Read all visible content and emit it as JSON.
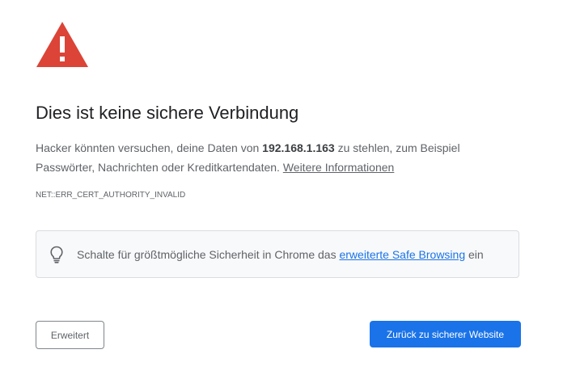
{
  "icons": {
    "warning": "warning-triangle-icon",
    "bulb": "lightbulb-icon"
  },
  "colors": {
    "warning_red": "#db4437",
    "primary_blue": "#1a73e8",
    "text_secondary": "#5f6368"
  },
  "heading": "Dies ist keine sichere Verbindung",
  "explanation": {
    "before_host": "Hacker könnten versuchen, deine Daten von ",
    "host": "192.168.1.163",
    "after_host": " zu stehlen, zum Beispiel Passwörter, Nachrichten oder Kreditkartendaten. ",
    "learn_more": "Weitere Informationen"
  },
  "error_code": "NET::ERR_CERT_AUTHORITY_INVALID",
  "enhanced_protection": {
    "before_link": "Schalte für größtmögliche Sicherheit in Chrome das ",
    "link": "erweiterte Safe Browsing",
    "after_link": " ein"
  },
  "buttons": {
    "advanced": "Erweitert",
    "back_to_safety": "Zurück zu sicherer Website"
  }
}
